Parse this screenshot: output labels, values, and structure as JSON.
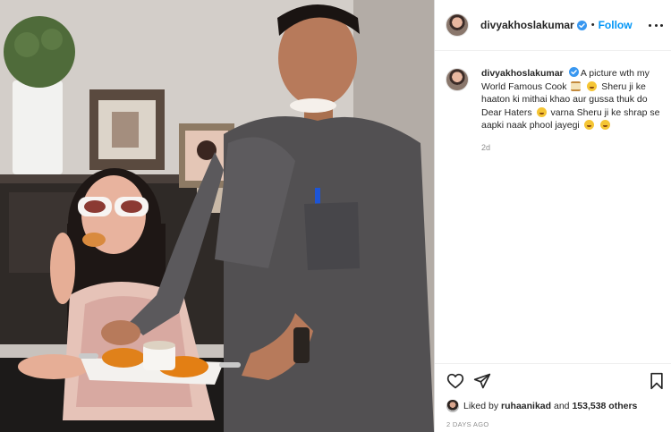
{
  "post": {
    "username": "divyakhoslakumar",
    "follow_label": "Follow",
    "separator": "•",
    "caption_parts": [
      "A picture wth my World Famous Cook",
      "Sheru ji ke haaton ki mithai khao aur gussa thuk do Dear Haters",
      "varna Sheru ji ke shrap se aapki naak phool jayegi"
    ],
    "time_ago": "2d",
    "liked_by_prefix": "Liked by",
    "liked_by_user": "ruhaanikad",
    "liked_by_and": "and",
    "others_count": "153,538 others",
    "date_label": "2 DAYS AGO"
  },
  "icons": {
    "verified": "verified-badge-icon",
    "more": "more-options-icon",
    "like": "heart-icon",
    "comment": "comment-icon",
    "share": "paper-plane-icon",
    "save": "bookmark-icon"
  },
  "colors": {
    "follow": "#0095f6",
    "verified": "#3897f0",
    "muted": "#8e8e8e",
    "text": "#262626"
  }
}
